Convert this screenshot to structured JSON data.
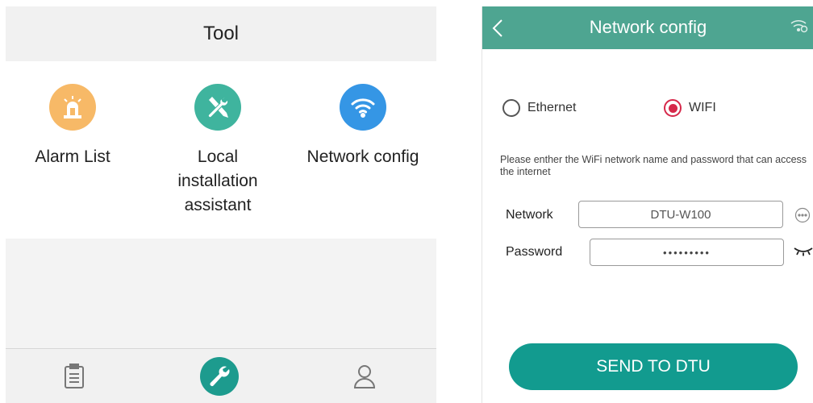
{
  "tool_screen": {
    "title": "Tool",
    "tools": [
      {
        "label": "Alarm List",
        "icon": "alarm-siren-icon",
        "color": "#f7b967"
      },
      {
        "label": "Local installation assistant",
        "icon": "tools-icon",
        "color": "#3fb49e"
      },
      {
        "label": "Network config",
        "icon": "wifi-icon",
        "color": "#3596e5"
      }
    ],
    "tabs": [
      {
        "icon": "clipboard-icon"
      },
      {
        "icon": "wrench-icon",
        "active": true,
        "color": "#1d9b8e"
      },
      {
        "icon": "user-icon"
      }
    ]
  },
  "network_screen": {
    "title": "Network config",
    "header_color": "#4ea591",
    "radios": [
      {
        "label": "Ethernet",
        "selected": false
      },
      {
        "label": "WIFI",
        "selected": true,
        "color": "#d6284a"
      }
    ],
    "instruction": "Please enther the WiFi network name and password that can access the internet",
    "network_label": "Network",
    "network_value": "DTU-W100",
    "password_label": "Password",
    "password_value": "•••••••••",
    "send_button": "SEND TO DTU",
    "send_color": "#129b8f"
  }
}
